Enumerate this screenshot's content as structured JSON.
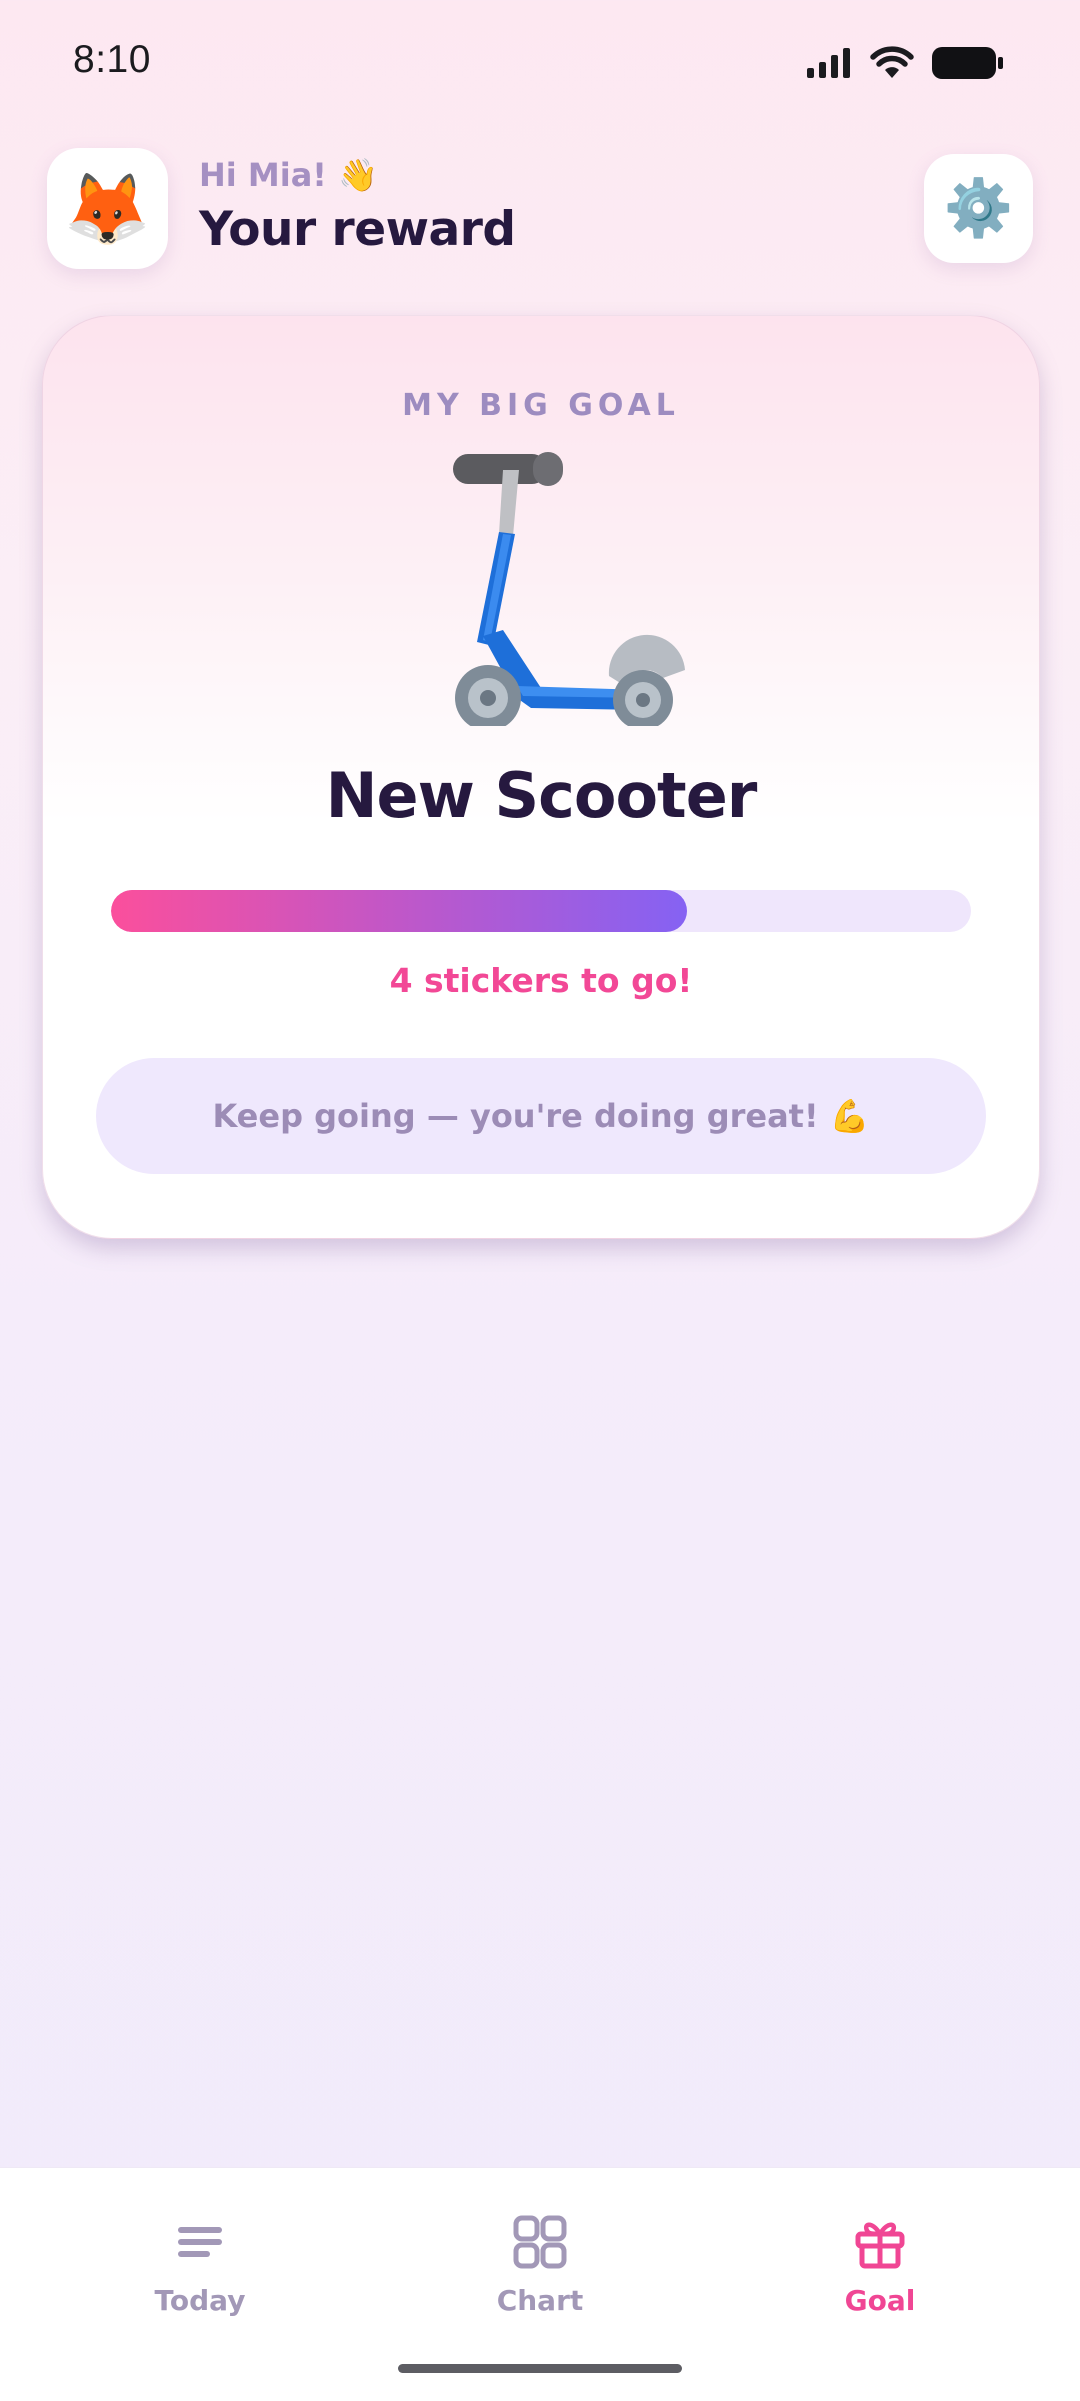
{
  "status_bar": {
    "time": "8:10",
    "icons": [
      "signal-icon",
      "wifi-icon",
      "battery-icon"
    ]
  },
  "header": {
    "avatar": "🦊",
    "greeting": "Hi Mia!",
    "greeting_emoji": "👋",
    "title": "Your reward",
    "settings_icon": "⚙️"
  },
  "goal": {
    "label": "MY BIG GOAL",
    "image": "scooter",
    "name": "New Scooter",
    "progress_fraction": 0.67,
    "remaining_text": "4 stickers to go!",
    "encouragement": "Keep going — you're doing great! 💪"
  },
  "nav": {
    "items": [
      {
        "label": "Today",
        "icon": "list-icon"
      },
      {
        "label": "Chart",
        "icon": "grid-icon"
      },
      {
        "label": "Goal",
        "icon": "gift-icon"
      }
    ],
    "active": "Goal"
  },
  "colors": {
    "accent_pink": "#f04694",
    "accent_purple": "#8562f3",
    "text_dark": "#26193f",
    "muted_purple": "#a590c2"
  }
}
